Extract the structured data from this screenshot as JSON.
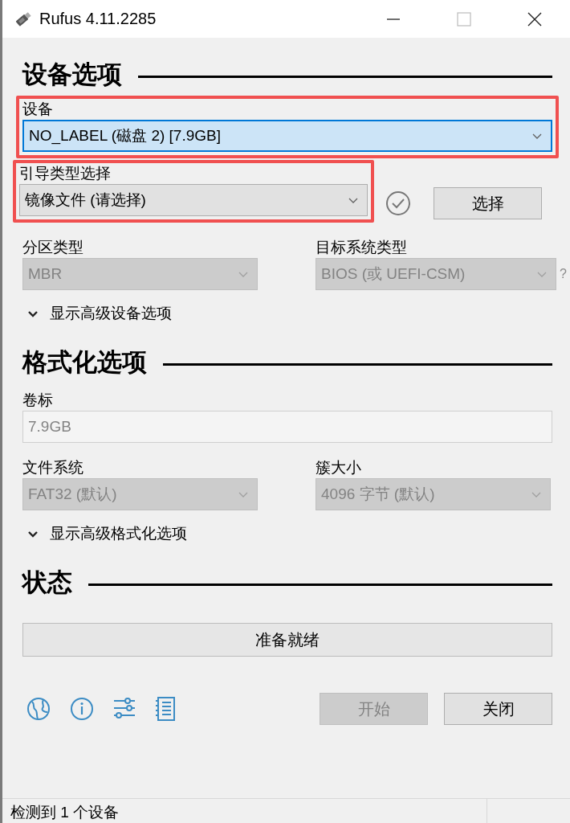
{
  "window": {
    "title": "Rufus 4.11.2285"
  },
  "drive_properties": {
    "heading": "设备选项",
    "device": {
      "label": "设备",
      "value": "NO_LABEL (磁盘 2) [7.9GB]",
      "focused": true,
      "highlighted": true
    },
    "boot_selection": {
      "label": "引导类型选择",
      "value": "镜像文件 (请选择)",
      "highlighted": true
    },
    "select_button": "选择",
    "partition_scheme": {
      "label": "分区类型",
      "value": "MBR",
      "disabled": true
    },
    "target_system": {
      "label": "目标系统类型",
      "value": "BIOS (或 UEFI-CSM)",
      "disabled": true
    },
    "help_mark": "?",
    "advanced_toggle": {
      "label": "显示高级设备选项",
      "expanded": false
    }
  },
  "format_options": {
    "heading": "格式化选项",
    "volume_label": {
      "label": "卷标",
      "value": "7.9GB",
      "disabled": true
    },
    "file_system": {
      "label": "文件系统",
      "value": "FAT32 (默认)",
      "disabled": true
    },
    "cluster_size": {
      "label": "簇大小",
      "value": "4096 字节 (默认)",
      "disabled": true
    },
    "advanced_toggle": {
      "label": "显示高级格式化选项",
      "expanded": false
    }
  },
  "status": {
    "heading": "状态",
    "progress_text": "准备就绪"
  },
  "buttons": [
    {
      "label": "开始",
      "disabled": true
    },
    {
      "label": "关闭",
      "disabled": false
    }
  ],
  "status_bar": {
    "text": "检测到 1 个设备"
  }
}
